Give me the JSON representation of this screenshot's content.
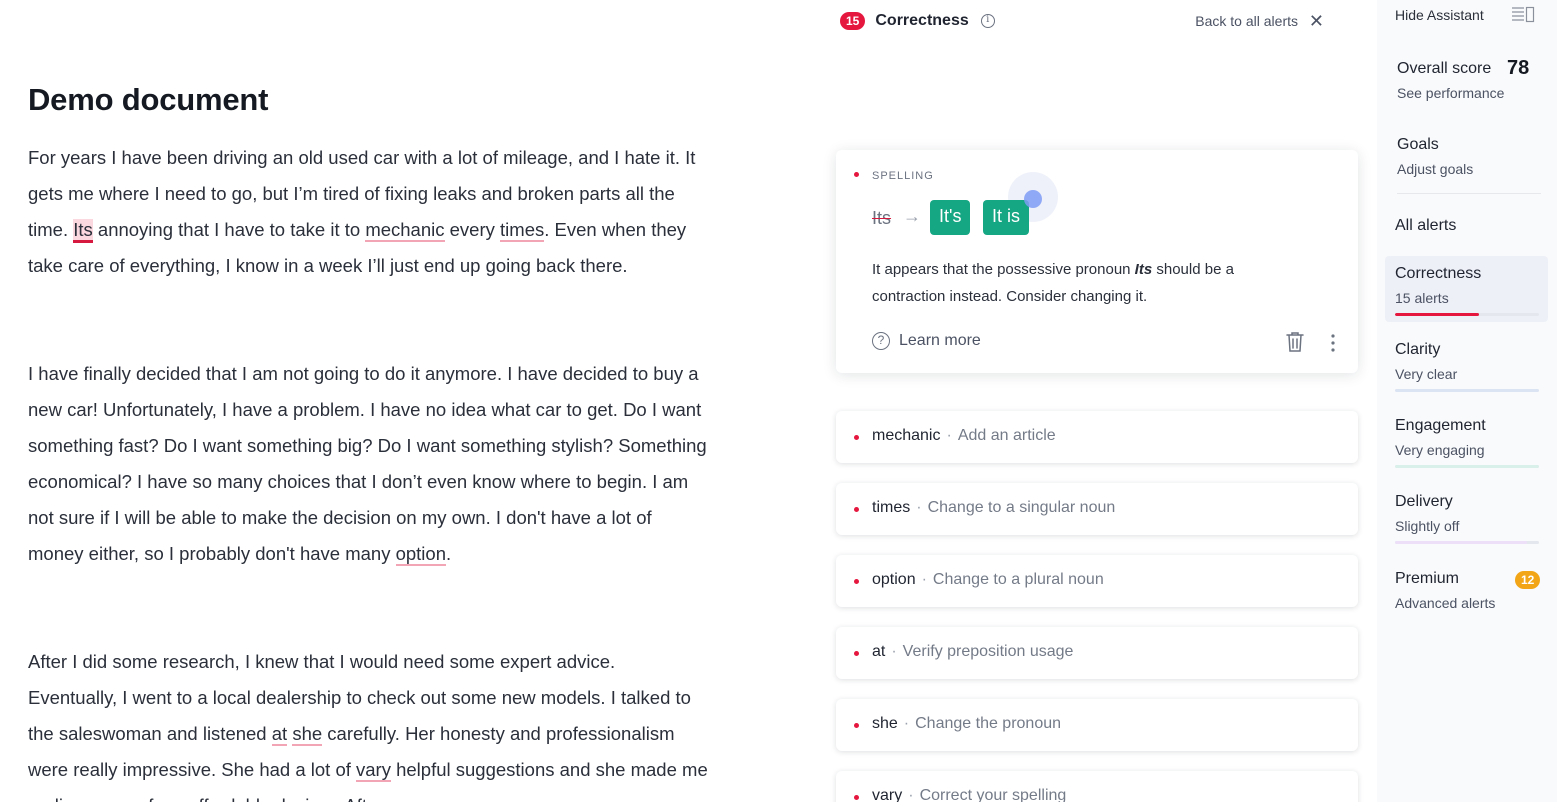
{
  "document": {
    "title": "Demo document",
    "p1": {
      "a": "For years I have been driving an old used car with a lot of mileage, and I hate it. It gets me where I need to go, but I’m tired of fixing leaks and broken parts all the time. ",
      "its": "Its",
      "b": " annoying that I have to take it to ",
      "mechanic": "mechanic",
      "c": " every ",
      "times": "times",
      "d": ". Even when they take care of everything, I know in a week I’ll just end up going back there."
    },
    "p2": {
      "a": "I have finally decided that I am not going to do it anymore. I have decided to buy a new car! Unfortunately, I have a problem. I have no idea what car to get. Do I want something fast? Do I want something big? Do I want something stylish? Something economical? I have so many choices that I don’t even know where to begin. I am not sure if I will be able to make the decision on my own. I don't have a lot of money either, so I probably don't have many ",
      "option": "option",
      "b": "."
    },
    "p3": {
      "a": "After I did some research, I knew that I would need some expert advice. Eventually, I went to a local dealership to check out some new models. I talked to the saleswoman and listened ",
      "at": "at",
      "b": " ",
      "she": "she",
      "c": " carefully. Her honesty and professionalism were really impressive. She had a lot of ",
      "vary": "vary",
      "d": " helpful suggestions and she made me realize many of my affordable desires. Aft"
    }
  },
  "panel": {
    "count": "15",
    "title": "Correctness",
    "back_label": "Back to all alerts",
    "active_card": {
      "category": "SPELLING",
      "original": "Its",
      "suggestions": [
        "It's",
        "It is"
      ],
      "explanation_1": "It appears that the possessive pronoun ",
      "explanation_word": "Its",
      "explanation_2": " should be a contraction instead. Consider changing it.",
      "learn_more": "Learn more"
    },
    "alerts": [
      {
        "word": "mechanic",
        "desc": "Add an article"
      },
      {
        "word": "times",
        "desc": "Change to a singular noun"
      },
      {
        "word": "option",
        "desc": "Change to a plural noun"
      },
      {
        "word": "at",
        "desc": "Verify preposition usage"
      },
      {
        "word": "she",
        "desc": "Change the pronoun"
      },
      {
        "word": "vary",
        "desc": "Correct your spelling"
      }
    ],
    "separator": "·"
  },
  "sidebar": {
    "hide_assistant": "Hide Assistant",
    "overall_score_label": "Overall score",
    "overall_score": "78",
    "see_performance": "See performance",
    "goals": "Goals",
    "adjust_goals": "Adjust goals",
    "all_alerts": "All alerts",
    "categories": [
      {
        "name": "Correctness",
        "sub": "15 alerts",
        "fill": 0.58,
        "color": "#e5173f"
      },
      {
        "name": "Clarity",
        "sub": "Very clear",
        "fill": 1.0,
        "color": "#dbe4f3"
      },
      {
        "name": "Engagement",
        "sub": "Very engaging",
        "fill": 1.0,
        "color": "#d9efe9"
      },
      {
        "name": "Delivery",
        "sub": "Slightly off",
        "fill": 0.92,
        "color": "#ecdff7"
      }
    ],
    "premium": {
      "name": "Premium",
      "sub": "Advanced alerts",
      "count": "12"
    }
  }
}
